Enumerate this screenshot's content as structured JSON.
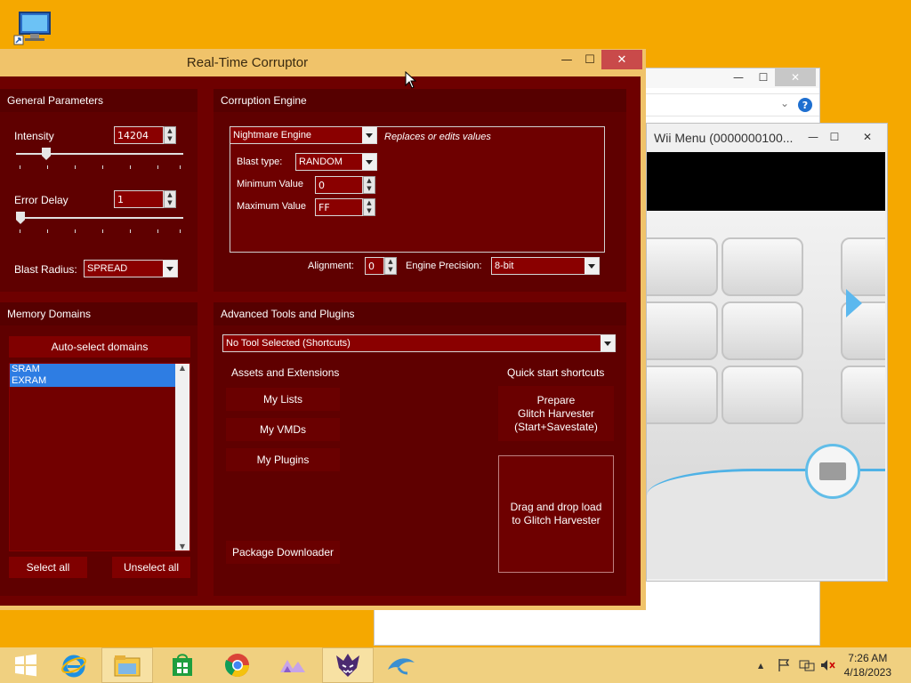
{
  "rtc": {
    "title": "Real-Time Corruptor",
    "window_buttons": {
      "minimize": "—",
      "maximize": "☐",
      "close": "✕"
    },
    "general": {
      "header": "General Parameters",
      "intensity_label": "Intensity",
      "intensity_value": "14204",
      "error_delay_label": "Error Delay",
      "error_delay_value": "1",
      "blast_radius_label": "Blast Radius:",
      "blast_radius_value": "SPREAD"
    },
    "engine": {
      "header": "Corruption Engine",
      "engine_value": "Nightmare Engine",
      "engine_desc": "Replaces or edits values",
      "blast_type_label": "Blast type:",
      "blast_type_value": "RANDOM",
      "min_label": "Minimum Value",
      "min_value": "0",
      "max_label": "Maximum Value",
      "max_value": "FF",
      "alignment_label": "Alignment:",
      "alignment_value": "0",
      "precision_label": "Engine Precision:",
      "precision_value": "8-bit"
    },
    "memory": {
      "header": "Memory Domains",
      "auto_select": "Auto-select domains",
      "domains": [
        "SRAM",
        "EXRAM"
      ],
      "select_all": "Select all",
      "unselect_all": "Unselect all"
    },
    "advanced": {
      "header": "Advanced Tools and Plugins",
      "tool_select": "No Tool Selected (Shortcuts)",
      "assets_header": "Assets and Extensions",
      "my_lists": "My Lists",
      "my_vmds": "My VMDs",
      "my_plugins": "My Plugins",
      "package_downloader": "Package Downloader",
      "quick_header": "Quick start shortcuts",
      "prepare_line1": "Prepare",
      "prepare_line2": "Glitch Harvester",
      "prepare_line3": "(Start+Savestate)",
      "drag_line1": "Drag and drop load",
      "drag_line2": "to Glitch Harvester"
    }
  },
  "wii": {
    "title": "Wii Menu (0000000100...",
    "window_buttons": {
      "minimize": "—",
      "maximize": "☐",
      "close": "✕"
    }
  },
  "explorer": {
    "window_buttons": {
      "minimize": "—",
      "maximize": "☐",
      "close": "✕"
    },
    "help": "?"
  },
  "taskbar": {
    "time": "7:26 AM",
    "date": "4/18/2023",
    "tray_up": "▲"
  }
}
